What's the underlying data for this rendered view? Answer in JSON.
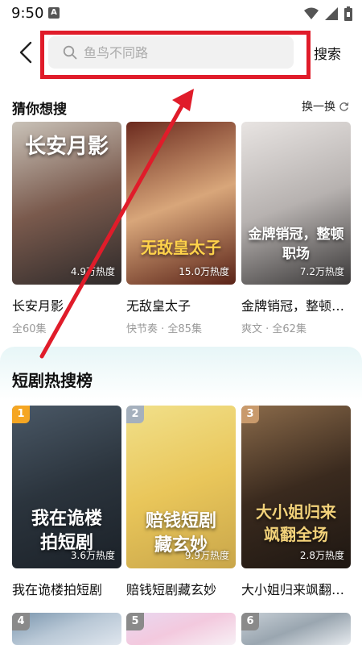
{
  "status": {
    "time": "9:50",
    "app_badge": "A"
  },
  "header": {
    "back_icon": "chevron-left-icon",
    "search_placeholder": "鱼鸟不同路",
    "search_label": "搜索"
  },
  "guess": {
    "title": "猜你想搜",
    "refresh_label": "换一换",
    "items": [
      {
        "name": "长安月影",
        "meta": "全60集",
        "heat": "4.9万热度",
        "poster_text": "长安月影",
        "colors": [
          "#c9c2b8",
          "#7a5a4d",
          "#2e2a2a"
        ]
      },
      {
        "name": "无敌皇太子",
        "meta": "快节奏 · 全85集",
        "heat": "15.0万热度",
        "poster_text": "无敌皇太子",
        "colors": [
          "#6b2a1e",
          "#d8a67a",
          "#5a2318"
        ]
      },
      {
        "name": "金牌销冠，整顿职场",
        "meta": "爽文 · 全62集",
        "heat": "7.2万热度",
        "poster_text": "金牌销冠，整顿职场",
        "colors": [
          "#e8e4e2",
          "#b7b2b0",
          "#3a3838"
        ]
      }
    ]
  },
  "hot": {
    "title": "短剧热搜榜",
    "items": [
      {
        "rank": "1",
        "name": "我在诡楼拍短剧",
        "heat": "3.6万热度",
        "poster_text": "我在诡楼拍短剧",
        "badge_color": "#f5a623",
        "colors": [
          "#4a5866",
          "#2b343d",
          "#1b2128"
        ]
      },
      {
        "rank": "2",
        "name": "赔钱短剧藏玄妙",
        "heat": "9.9万热度",
        "poster_text": "赔钱短剧藏玄妙",
        "badge_color": "#a5b0bd",
        "colors": [
          "#f1e08a",
          "#e9c65a",
          "#c9a64a"
        ]
      },
      {
        "rank": "3",
        "name": "大小姐归来飒翻全场",
        "heat": "2.8万热度",
        "poster_text": "大小姐归来飒翻全场",
        "badge_color": "#c99a6c",
        "colors": [
          "#8a6a4a",
          "#3a2a1e",
          "#1e1712"
        ]
      },
      {
        "rank": "4",
        "badge_color": "#8a8a8a",
        "colors": [
          "#7b96ae",
          "#b9c8d6",
          "#dfe6ee"
        ]
      },
      {
        "rank": "5",
        "badge_color": "#8a8a8a",
        "colors": [
          "#e9d8f0",
          "#f3c9de",
          "#f7f0f5"
        ]
      },
      {
        "rank": "6",
        "badge_color": "#8a8a8a",
        "colors": [
          "#c7cfd6",
          "#9aa6b0",
          "#e6eaee"
        ]
      }
    ]
  },
  "overlay": {
    "frame_color": "#e01c2a",
    "arrow_color": "#e01c2a"
  }
}
